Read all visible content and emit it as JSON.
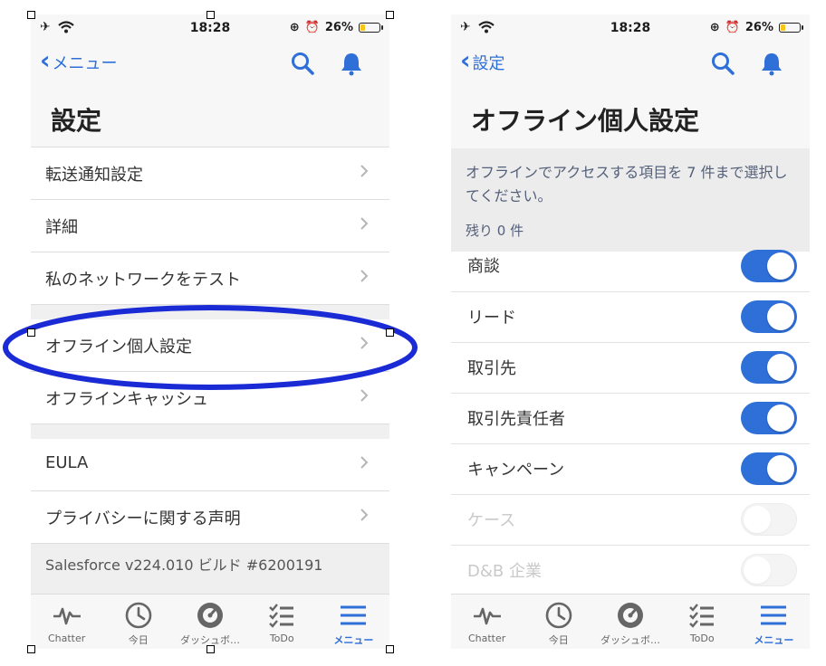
{
  "status": {
    "time": "18:28",
    "battery": "26%",
    "battery_level": 0.26
  },
  "left": {
    "back_label": "メニュー",
    "title": "設定",
    "group1": [
      "転送通知設定",
      "詳細",
      "私のネットワークをテスト"
    ],
    "group2": [
      "オフライン個人設定",
      "オフラインキャッシュ"
    ],
    "group3": [
      "EULA",
      "プライバシーに関する声明"
    ],
    "version": "Salesforce v224.010 ビルド #6200191"
  },
  "right": {
    "back_label": "設定",
    "title": "オフライン個人設定",
    "description": "オフラインでアクセスする項目を 7 件まで選択してください。",
    "remaining": "残り 0 件",
    "items": [
      {
        "label": "商談",
        "on": true
      },
      {
        "label": "リード",
        "on": true
      },
      {
        "label": "取引先",
        "on": true
      },
      {
        "label": "取引先責任者",
        "on": true
      },
      {
        "label": "キャンペーン",
        "on": true
      },
      {
        "label": "ケース",
        "on": false
      },
      {
        "label": "D&B 企業",
        "on": false
      }
    ]
  },
  "tabs": [
    {
      "label": "Chatter",
      "icon": "pulse-icon"
    },
    {
      "label": "今日",
      "icon": "clock-icon"
    },
    {
      "label": "ダッシュボ…",
      "icon": "gauge-icon"
    },
    {
      "label": "ToDo",
      "icon": "checklist-icon"
    },
    {
      "label": "メニュー",
      "icon": "menu-icon",
      "active": true
    }
  ],
  "colors": {
    "accent": "#2f6fd8",
    "annotation": "#1a2bd6"
  }
}
